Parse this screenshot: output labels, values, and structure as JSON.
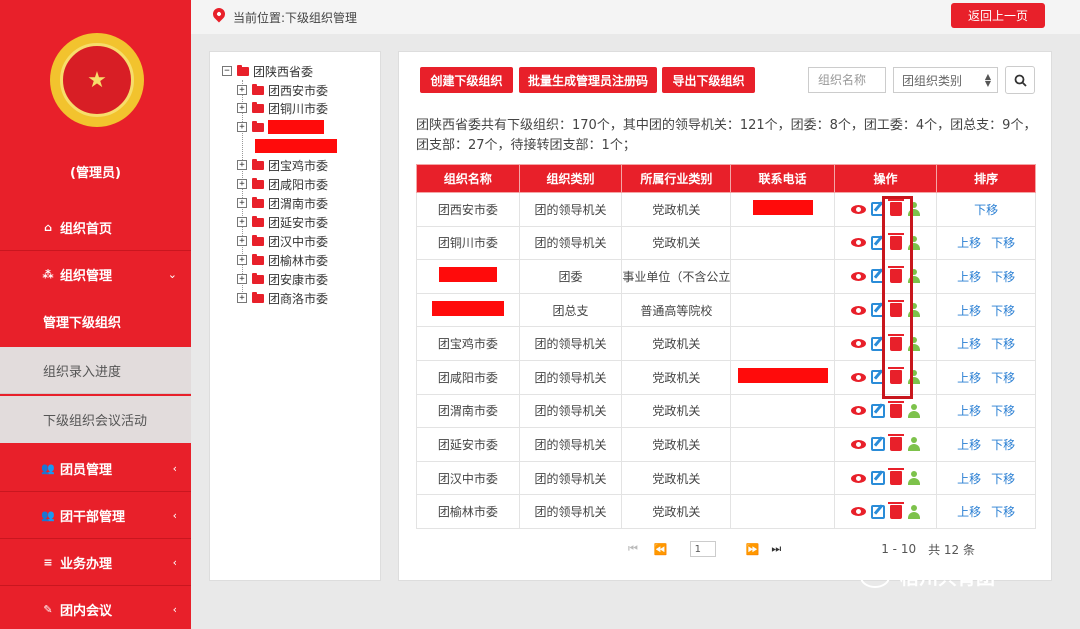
{
  "sidebar": {
    "admin_label": "(管理员)",
    "items": [
      {
        "label": "组织首页",
        "icon": "home-icon"
      },
      {
        "label": "组织管理",
        "icon": "sitemap-icon"
      },
      {
        "label": "团员管理",
        "icon": "users-icon"
      },
      {
        "label": "团干部管理",
        "icon": "users-icon"
      },
      {
        "label": "业务办理",
        "icon": "list-icon"
      },
      {
        "label": "团内会议",
        "icon": "edit-icon"
      }
    ],
    "submenu": [
      {
        "label": "管理下级组织",
        "active": true
      },
      {
        "label": "组织录入进度",
        "active": false
      },
      {
        "label": "下级组织会议活动",
        "active": false
      }
    ]
  },
  "topbar": {
    "location": "当前位置:下级组织管理",
    "back_label": "返回上一页"
  },
  "tree": {
    "root": "团陕西省委",
    "children": [
      "团西安市委",
      "团铜川市委",
      "",
      "",
      "团宝鸡市委",
      "团咸阳市委",
      "团渭南市委",
      "团延安市委",
      "团汉中市委",
      "团榆林市委",
      "团安康市委",
      "团商洛市委"
    ]
  },
  "toolbar": {
    "create_label": "创建下级组织",
    "batch_label": "批量生成管理员注册码",
    "export_label": "导出下级组织",
    "search_placeholder": "组织名称",
    "type_select_value": "团组织类别"
  },
  "summary_text": "团陕西省委共有下级组织：170个，其中团的领导机关：121个，团委：8个，团工委：4个，团总支：9个，团支部：27个，待接转团支部：1个；",
  "table": {
    "headers": [
      "组织名称",
      "组织类别",
      "所属行业类别",
      "联系电话",
      "操作",
      "排序"
    ],
    "rows": [
      {
        "name": "团西安市委",
        "type": "团的领导机关",
        "industry": "党政机关",
        "up": "",
        "down": "下移"
      },
      {
        "name": "团铜川市委",
        "type": "团的领导机关",
        "industry": "党政机关",
        "up": "上移",
        "down": "下移"
      },
      {
        "name": "",
        "type": "团委",
        "industry": "事业单位（不含公立",
        "up": "上移",
        "down": "下移"
      },
      {
        "name": "",
        "type": "团总支",
        "industry": "普通高等院校",
        "up": "上移",
        "down": "下移"
      },
      {
        "name": "团宝鸡市委",
        "type": "团的领导机关",
        "industry": "党政机关",
        "up": "上移",
        "down": "下移"
      },
      {
        "name": "团咸阳市委",
        "type": "团的领导机关",
        "industry": "党政机关",
        "up": "上移",
        "down": "下移"
      },
      {
        "name": "团渭南市委",
        "type": "团的领导机关",
        "industry": "党政机关",
        "up": "上移",
        "down": "下移"
      },
      {
        "name": "团延安市委",
        "type": "团的领导机关",
        "industry": "党政机关",
        "up": "上移",
        "down": "下移"
      },
      {
        "name": "团汉中市委",
        "type": "团的领导机关",
        "industry": "党政机关",
        "up": "上移",
        "down": "下移"
      },
      {
        "name": "团榆林市委",
        "type": "团的领导机关",
        "industry": "党政机关",
        "up": "上移",
        "down": "下移"
      }
    ]
  },
  "pager": {
    "page": "1",
    "range": "1 - 10",
    "total": "共 12 条"
  },
  "watermark": "梧州共青团",
  "colors": {
    "brand": "#e8202a",
    "link": "#2a7fd3",
    "edit": "#2a8cd8",
    "user": "#7dc24b"
  }
}
